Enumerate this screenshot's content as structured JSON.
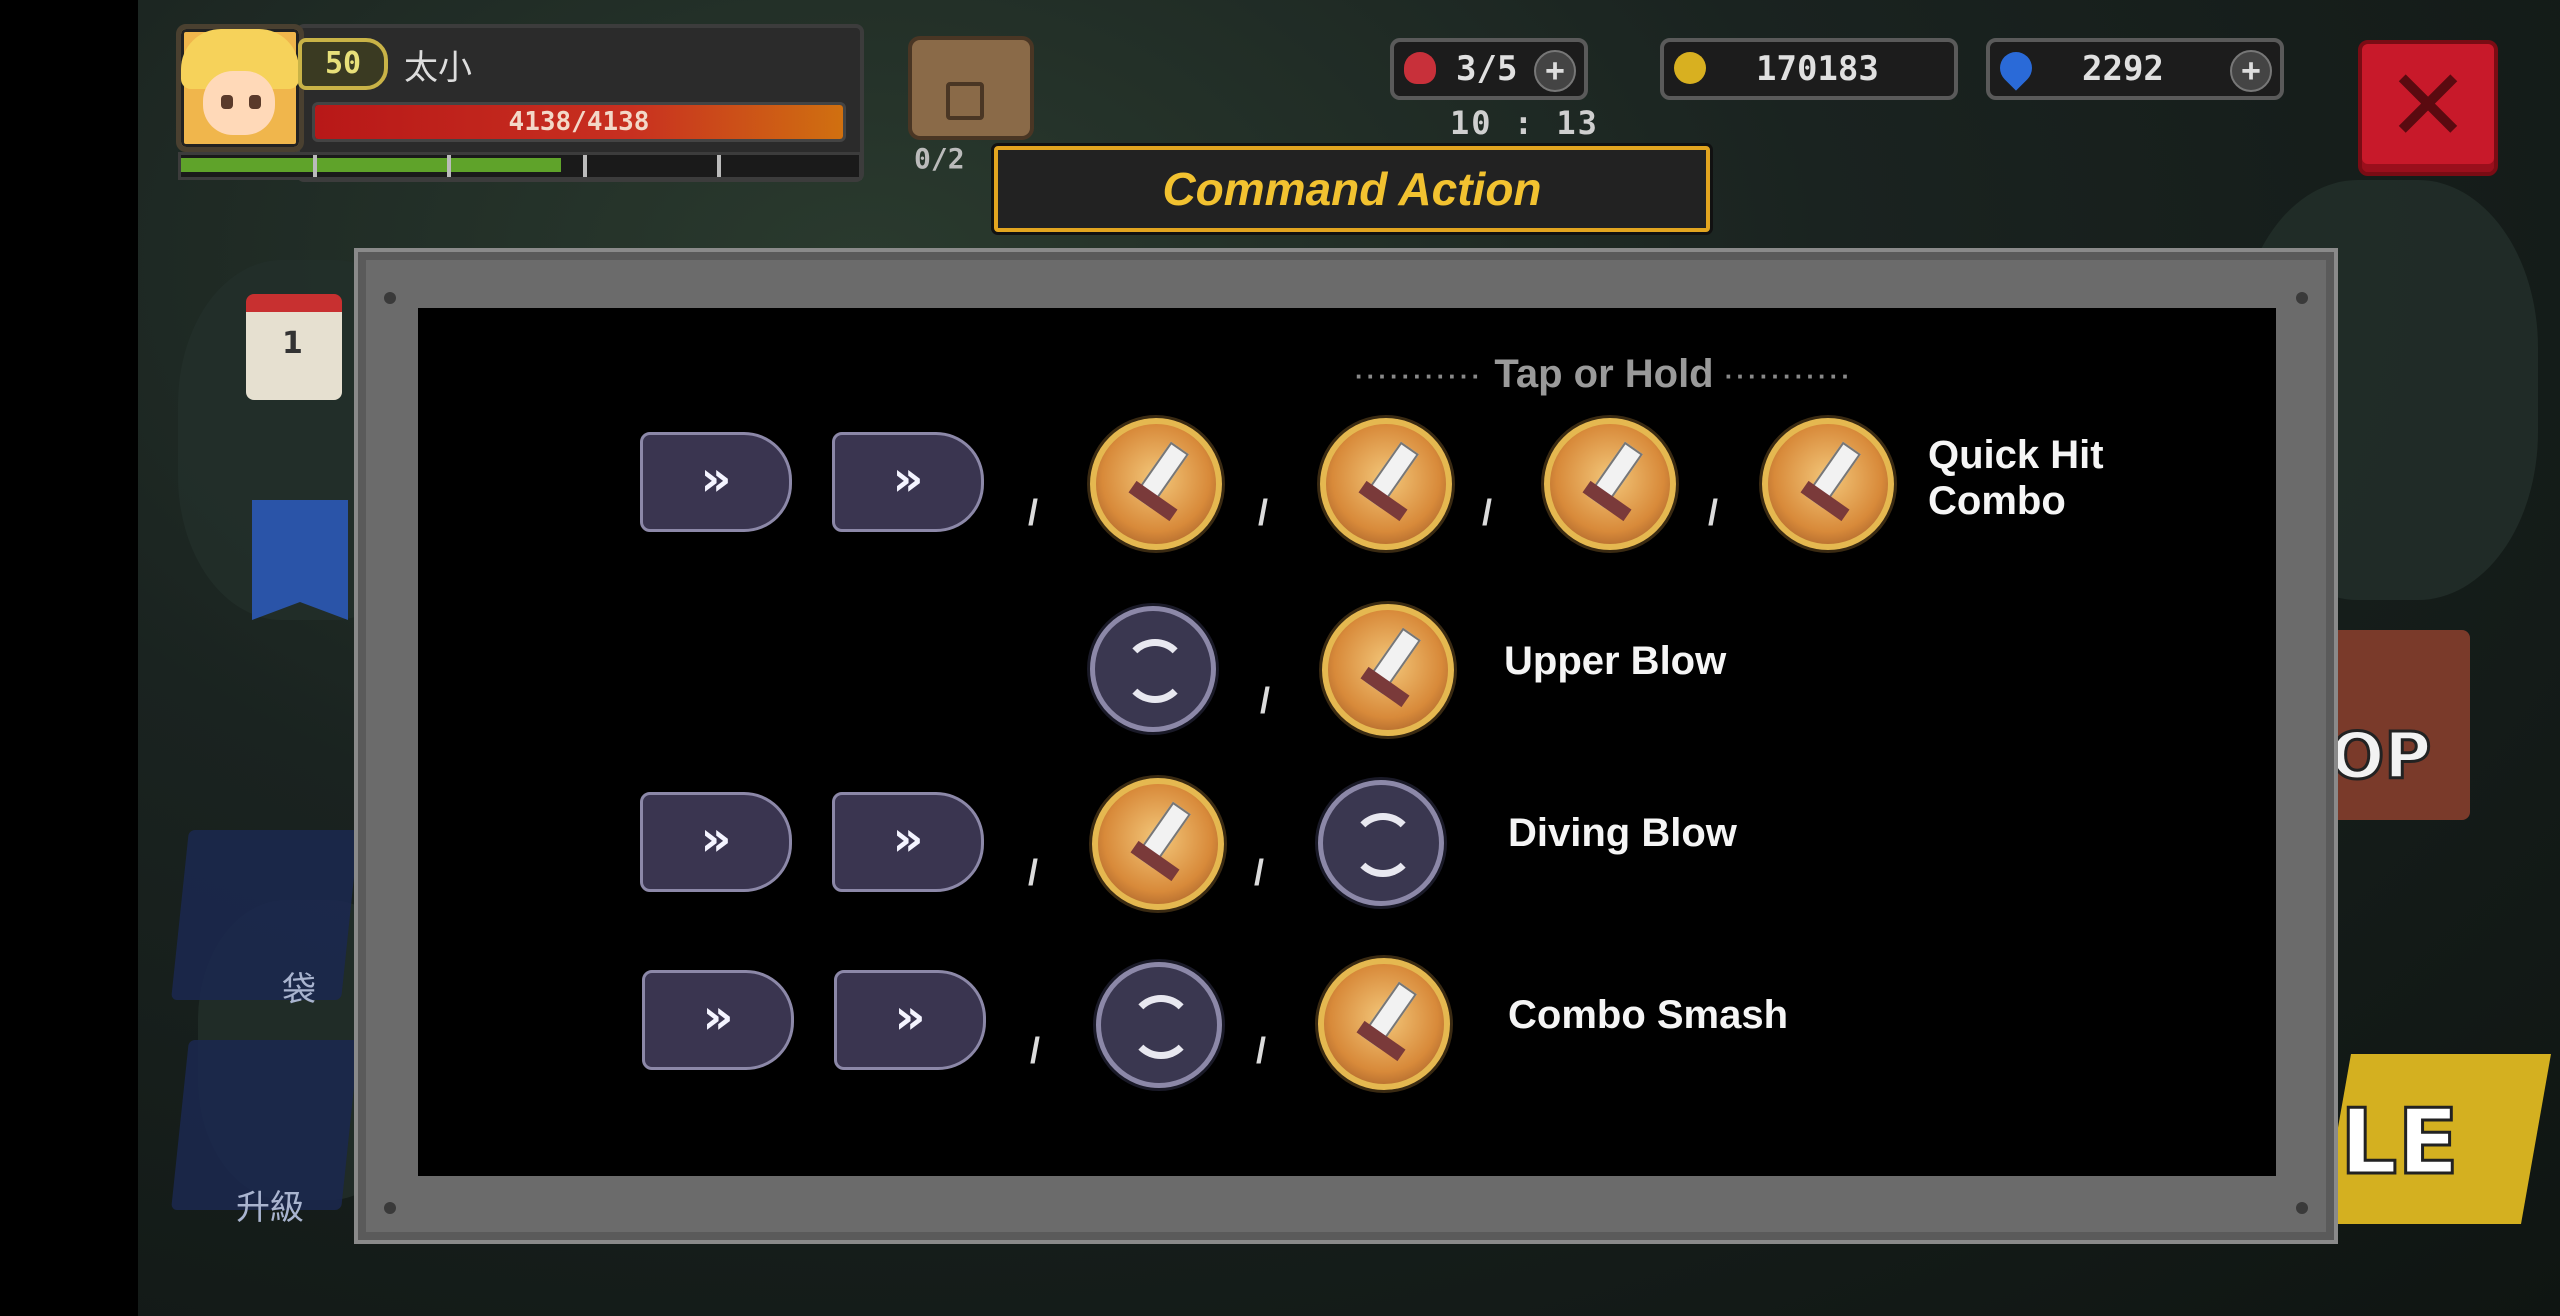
{
  "hud": {
    "level": "50",
    "player_name": "太小",
    "hp_text": "4138/4138",
    "hp_fraction": 1.0,
    "exp_fraction": 0.56,
    "bag_count": "0/2",
    "hearts": "3/5",
    "gold": "170183",
    "gems": "2292",
    "timer": "10 : 13",
    "close_symbol": "✕"
  },
  "side_menu": {
    "bag_label": "袋",
    "upgrade_label": "升級",
    "calendar_day": "1",
    "shop_partial": "OP",
    "battle_partial": "LE"
  },
  "modal": {
    "title": "Command Action",
    "tap_or_hold": "Tap or Hold",
    "dots": "···········",
    "arrow_glyph": "»",
    "separator": "/",
    "commands": [
      {
        "label_line1": "Quick Hit",
        "label_line2": "Combo"
      },
      {
        "label_line1": "Upper Blow"
      },
      {
        "label_line1": "Diving Blow"
      },
      {
        "label_line1": "Combo Smash"
      }
    ]
  },
  "colors": {
    "accent_gold": "#e2a520",
    "close_red": "#c8192a",
    "button_purple": "#3a3550"
  },
  "icons": [
    "heart-icon",
    "gold-coin-icon",
    "gem-icon",
    "plus-icon",
    "close-icon",
    "sword-attack-icon",
    "skill-swirl-icon",
    "dash-arrow-icon",
    "bag-icon",
    "calendar-icon",
    "trophy-banner-icon",
    "upgrade-icon"
  ]
}
